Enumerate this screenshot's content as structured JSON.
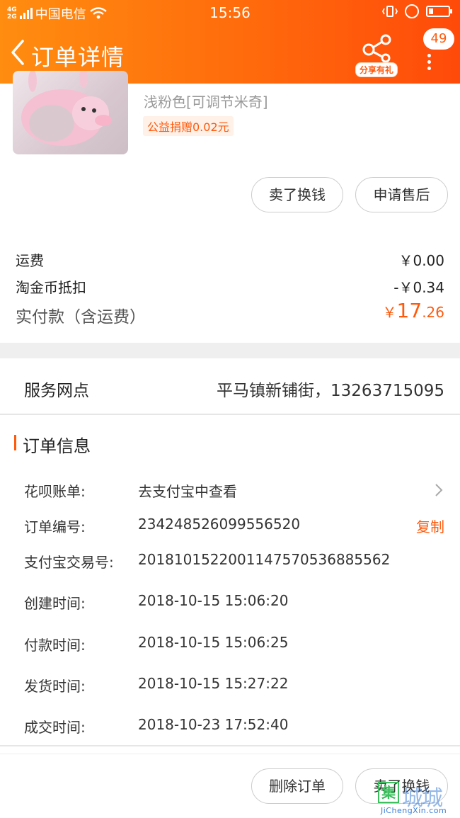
{
  "status_bar": {
    "signal_top": "4G",
    "signal_bottom": "2G",
    "carrier": "中国电信",
    "time": "15:56"
  },
  "navbar": {
    "title": "订单详情",
    "share_label": "分享有礼",
    "message_count": "49"
  },
  "product": {
    "spec": "浅粉色[可调节米奇]",
    "charity": "公益捐赠0.02元",
    "buttons": {
      "sell": "卖了换钱",
      "after_sale": "申请售后"
    }
  },
  "price": {
    "shipping_label": "运费",
    "shipping_value": "￥0.00",
    "coin_label": "淘金币抵扣",
    "coin_value": "-￥0.34",
    "total_label": "实付款（含运费）",
    "total_currency": "￥",
    "total_int": "17",
    "total_dec": ".26"
  },
  "service": {
    "label": "服务网点",
    "value": "平马镇新铺街，13263715095"
  },
  "order_info": {
    "title": "订单信息",
    "huabei_label": "花呗账单:",
    "huabei_value": "去支付宝中查看",
    "order_no_label": "订单编号:",
    "order_no_value": "234248526099556520",
    "copy_label": "复制",
    "alipay_label": "支付宝交易号:",
    "alipay_value": "2018101522001147570536885562",
    "created_label": "创建时间:",
    "created_value": "2018-10-15 15:06:20",
    "paid_label": "付款时间:",
    "paid_value": "2018-10-15 15:06:25",
    "shipped_label": "发货时间:",
    "shipped_value": "2018-10-15 15:27:22",
    "completed_label": "成交时间:",
    "completed_value": "2018-10-23 17:52:40"
  },
  "bottom_bar": {
    "delete_label": "删除订单",
    "sell_label": "卖了换钱"
  },
  "watermark": {
    "box_char": "集",
    "text": "城城信",
    "url": "JiChengXin.com"
  },
  "colors": {
    "header_start": "#ff8d10",
    "header_end": "#ff4a0a",
    "accent": "#ff5a0c"
  }
}
